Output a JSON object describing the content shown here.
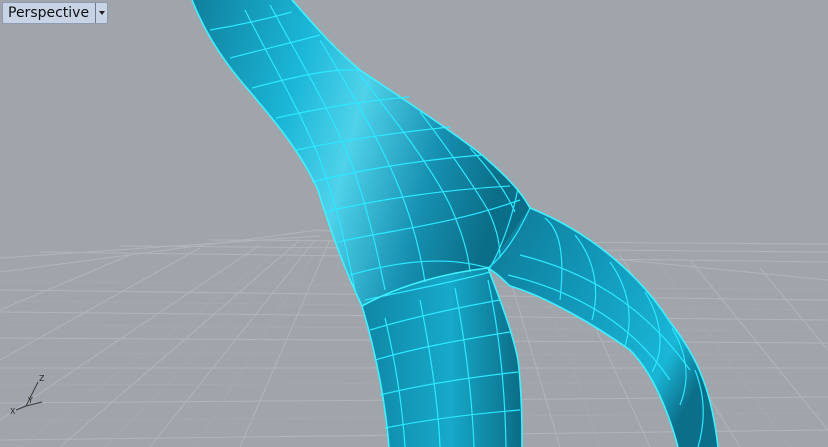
{
  "viewport": {
    "name": "Perspective",
    "dropdown_icon": "triangle-down-icon",
    "background_color": "#a0a5ab",
    "grid_color": "#b3b8be",
    "object_color": "#14a2c4",
    "isocurve_color": "#2ce8ff",
    "axes": {
      "x": "X",
      "y": "Y",
      "z": "Z"
    }
  }
}
